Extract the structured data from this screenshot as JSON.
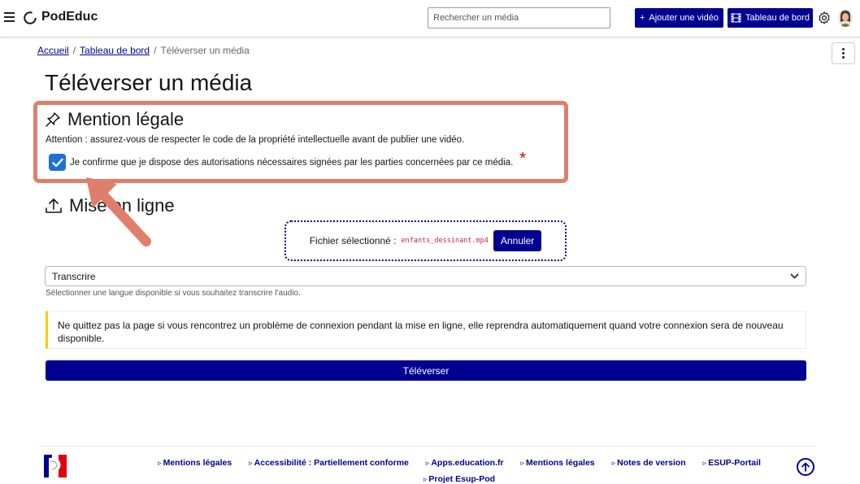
{
  "header": {
    "brand": "PodEduc",
    "search_placeholder": "Rechercher un média",
    "add_video_label": "Ajouter une vidéo",
    "dashboard_label": "Tableau de bord"
  },
  "breadcrumb": {
    "home": "Accueil",
    "dashboard": "Tableau de bord",
    "current": "Téléverser un média",
    "separator": "/"
  },
  "page": {
    "title": "Téléverser un média"
  },
  "legal": {
    "title": "Mention légale",
    "warning": "Attention : assurez-vous de respecter le code de la propriété intellectuelle avant de publier une vidéo.",
    "confirm_label": "Je confirme que je dispose des autorisations nécessaires signées par les parties concernées par ce média.",
    "confirm_checked": true,
    "required_mark": "*"
  },
  "upload": {
    "title": "Mise en ligne",
    "selected_label": "Fichier sélectionné :",
    "selected_file": "enfants_dessinant.mp4",
    "cancel_label": "Annuler",
    "transcribe_value": "Transcrire",
    "transcribe_help": "Sélectionner une langue disponible si vous souhaitez transcrire l'audio.",
    "notice": "Ne quittez pas la page si vous rencontrez un problème de connexion pendant la mise en ligne, elle reprendra automatiquement quand votre connexion sera de nouveau disponible.",
    "submit_label": "Téléverser"
  },
  "footer": {
    "links": [
      "Mentions légales",
      "Accessibilité : Partiellement conforme",
      "Apps.education.fr",
      "Mentions légales",
      "Notes de version",
      "ESUP-Portail",
      "Projet Esup-Pod"
    ]
  },
  "colors": {
    "primary": "#000091",
    "highlight": "#e07e6c",
    "required": "#ce0500",
    "notice_accent": "#ffca00",
    "checkbox": "#1f6fd6"
  },
  "icons": {
    "menu": "hamburger-icon",
    "logo": "podeduc-logo-icon",
    "add": "plus-icon",
    "dashboard": "film-icon",
    "settings": "gear-icon",
    "legal": "pushpin-icon",
    "upload": "upload-icon",
    "select": "chevron-down-icon",
    "back_to_top": "arrow-up-icon"
  }
}
